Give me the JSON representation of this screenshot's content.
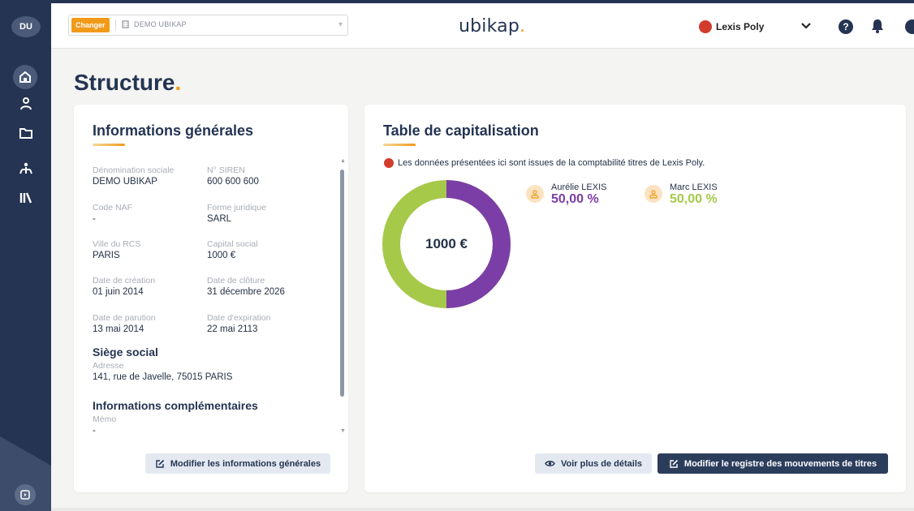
{
  "sidebar": {
    "avatar_initials": "DU",
    "items": [
      {
        "icon": "home-icon"
      },
      {
        "icon": "person-icon"
      },
      {
        "icon": "folder-icon"
      },
      {
        "icon": "org-chart-icon"
      },
      {
        "icon": "library-icon"
      }
    ],
    "footer_icon": "expand-sidebar-icon"
  },
  "topbar": {
    "change_label": "Changer",
    "company_name": "DEMO UBIKAP",
    "brand_name": "ubikap",
    "brand_dot": ".",
    "partner_name": "Lexis Poly"
  },
  "page": {
    "title": "Structure",
    "title_dot": "."
  },
  "general_info": {
    "title": "Informations générales",
    "fields": [
      {
        "label": "Dénomination sociale",
        "value": "DEMO UBIKAP"
      },
      {
        "label": "N° SIREN",
        "value": "600 600 600"
      },
      {
        "label": "Code NAF",
        "value": "-"
      },
      {
        "label": "Forme juridique",
        "value": "SARL"
      },
      {
        "label": "Ville du RCS",
        "value": "PARIS"
      },
      {
        "label": "Capital social",
        "value": "1000 €"
      },
      {
        "label": "Date de création",
        "value": "01 juin 2014"
      },
      {
        "label": "Date de clôture",
        "value": "31 décembre 2026"
      },
      {
        "label": "Date de parution",
        "value": "13 mai 2014"
      },
      {
        "label": "Date d'expiration",
        "value": "22 mai 2113"
      }
    ],
    "head_office": {
      "title": "Siège social",
      "address_label": "Adresse",
      "address_value": "141, rue de Javelle, 75015 PARIS"
    },
    "additional": {
      "title": "Informations complémentaires",
      "memo_label": "Mémo",
      "memo_value": "-"
    },
    "edit_button": "Modifier les informations générales"
  },
  "cap_table": {
    "title": "Table de capitalisation",
    "notice": "Les données présentées ici sont issues de la comptabilité titres de Lexis Poly.",
    "total": "1000 €",
    "holders": [
      {
        "name": "Aurélie LEXIS",
        "percent": "50,00 %",
        "color": "#7b3ea6"
      },
      {
        "name": "Marc LEXIS",
        "percent": "50,00 %",
        "color": "#a6c94a"
      }
    ],
    "details_button": "Voir plus de détails",
    "register_button": "Modifier le registre des mouvements de titres"
  },
  "colors": {
    "navy": "#243452",
    "accent": "#f29a1a",
    "purple": "#7b3ea6",
    "green": "#a6c94a"
  }
}
